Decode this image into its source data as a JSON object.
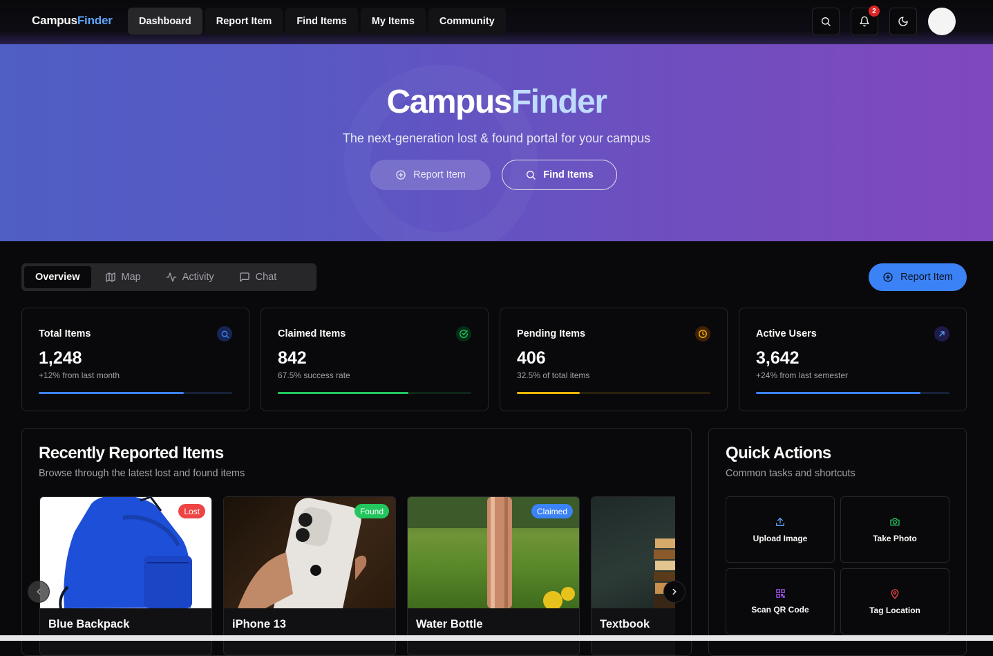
{
  "brand": {
    "part1": "Campus",
    "part2": "Finder"
  },
  "nav": {
    "links": [
      {
        "label": "Dashboard",
        "active": true
      },
      {
        "label": "Report Item"
      },
      {
        "label": "Find Items"
      },
      {
        "label": "My Items"
      },
      {
        "label": "Community"
      }
    ],
    "notification_count": "2"
  },
  "hero": {
    "title_part1": "Campus",
    "title_part2": "Finder",
    "subtitle": "The next-generation lost & found portal for your campus",
    "report_label": "Report Item",
    "find_label": "Find Items"
  },
  "tabs": [
    {
      "label": "Overview",
      "active": true
    },
    {
      "label": "Map",
      "icon": "map-icon"
    },
    {
      "label": "Activity",
      "icon": "activity-icon"
    },
    {
      "label": "Chat",
      "icon": "chat-icon"
    }
  ],
  "report_pill_label": "Report Item",
  "stats": [
    {
      "title": "Total Items",
      "value": "1,248",
      "note": "+12% from last month",
      "progress": 0.75,
      "color": "#3b82f6",
      "icon": "search-icon"
    },
    {
      "title": "Claimed Items",
      "value": "842",
      "note": "67.5% success rate",
      "progress": 0.675,
      "color": "#22c55e",
      "icon": "check-circle-icon"
    },
    {
      "title": "Pending Items",
      "value": "406",
      "note": "32.5% of total items",
      "progress": 0.325,
      "color": "#eab308",
      "icon": "clock-icon"
    },
    {
      "title": "Active Users",
      "value": "3,642",
      "note": "+24% from last semester",
      "progress": 0.85,
      "color": "#3b82f6",
      "icon": "trending-up-icon"
    }
  ],
  "recent": {
    "title": "Recently Reported Items",
    "subtitle": "Browse through the latest lost and found items",
    "items": [
      {
        "name": "Blue Backpack",
        "status": "Lost",
        "status_color": "#ef4444"
      },
      {
        "name": "iPhone 13",
        "status": "Found",
        "status_color": "#22c55e"
      },
      {
        "name": "Water Bottle",
        "status": "Claimed",
        "status_color": "#3b82f6"
      },
      {
        "name": "Textbook",
        "status": ""
      }
    ]
  },
  "quick": {
    "title": "Quick Actions",
    "subtitle": "Common tasks and shortcuts",
    "actions": [
      {
        "label": "Upload Image",
        "icon": "upload-icon",
        "color": "#60a5fa"
      },
      {
        "label": "Take Photo",
        "icon": "camera-icon",
        "color": "#22c55e"
      },
      {
        "label": "Scan QR Code",
        "icon": "qr-code-icon",
        "color": "#a855f7"
      },
      {
        "label": "Tag Location",
        "icon": "map-pin-icon",
        "color": "#ef4444"
      }
    ]
  }
}
